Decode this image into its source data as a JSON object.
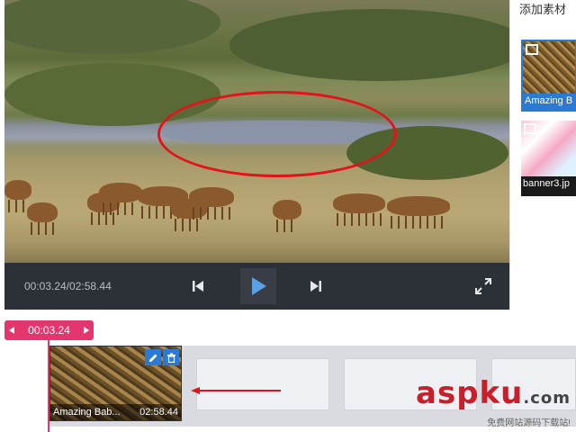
{
  "player": {
    "time_readout": "00:03.24/02:58.44",
    "icons": {
      "prev": "skip-previous-icon",
      "play": "play-icon",
      "next": "skip-next-icon",
      "fullscreen": "fullscreen-icon"
    }
  },
  "sidebar": {
    "title": "添加素材",
    "assets": [
      {
        "type": "video",
        "label": "Amazing B",
        "icon": "video-icon"
      },
      {
        "type": "image",
        "label": "banner3.jp",
        "icon": "image-icon"
      }
    ]
  },
  "timeline": {
    "playhead_time": "00:03.24",
    "clip": {
      "name": "Amazing Bab...",
      "duration": "02:58.44"
    }
  },
  "watermark": {
    "logo": "aspku",
    "logo_suffix": ".com",
    "subtitle": "免费网站源码下载站!"
  },
  "colors": {
    "accent_pink": "#e3356e",
    "accent_blue": "#2b7bd4",
    "control_bar": "#2c3037",
    "annotation_red": "#e0141a"
  }
}
